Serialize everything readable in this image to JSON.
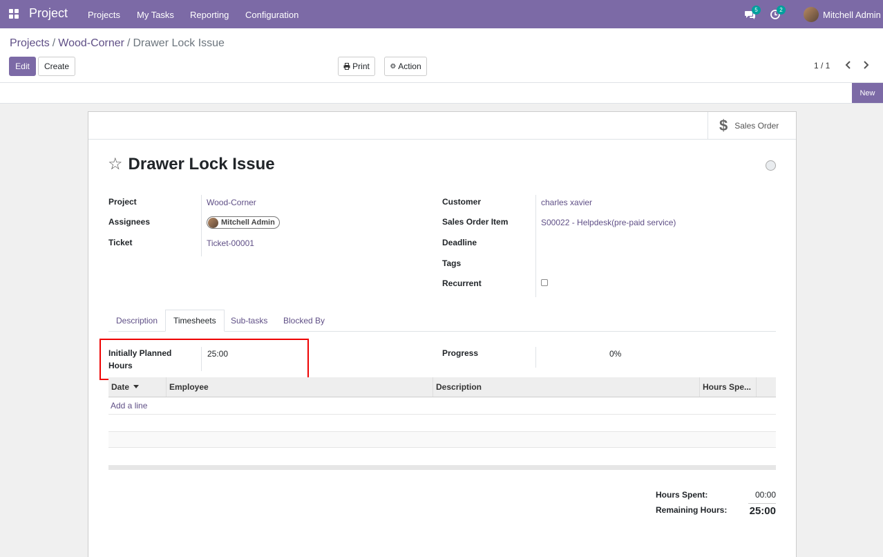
{
  "navbar": {
    "app_name": "Project",
    "menu": [
      "Projects",
      "My Tasks",
      "Reporting",
      "Configuration"
    ],
    "messages_count": "5",
    "activities_count": "2",
    "user_name": "Mitchell Admin",
    "icons": {
      "apps": "apps-grid-icon",
      "messages": "chat-bubbles-icon",
      "activities": "clock-icon"
    }
  },
  "breadcrumb": {
    "items": [
      "Projects",
      "Wood-Corner"
    ],
    "current": "Drawer Lock Issue",
    "separator": "/"
  },
  "toolbar": {
    "edit_label": "Edit",
    "create_label": "Create",
    "print_label": "Print",
    "action_label": "Action",
    "pager": "1 / 1"
  },
  "status_bar": {
    "stage": "New"
  },
  "smart_button": {
    "label": "Sales Order"
  },
  "task": {
    "title": "Drawer Lock Issue"
  },
  "fields_left": {
    "project_label": "Project",
    "project_value": "Wood-Corner",
    "assignees_label": "Assignees",
    "assignees_value": "Mitchell Admin",
    "ticket_label": "Ticket",
    "ticket_value": "Ticket-00001"
  },
  "fields_right": {
    "customer_label": "Customer",
    "customer_value": "charles xavier",
    "sales_order_item_label": "Sales Order Item",
    "sales_order_item_value": "S00022 - Helpdesk(pre-paid service)",
    "deadline_label": "Deadline",
    "tags_label": "Tags",
    "recurrent_label": "Recurrent"
  },
  "tabs": [
    "Description",
    "Timesheets",
    "Sub-tasks",
    "Blocked By"
  ],
  "timesheets": {
    "planned_label_1": "Initially Planned",
    "planned_label_2": "Hours",
    "planned_value": "25:00",
    "progress_label": "Progress",
    "progress_value": "0%",
    "columns": [
      "Date",
      "Employee",
      "Description",
      "Hours Spe..."
    ],
    "add_line": "Add a line",
    "hours_spent_label": "Hours Spent:",
    "hours_spent_value": "00:00",
    "remaining_label": "Remaining Hours:",
    "remaining_value": "25:00"
  }
}
